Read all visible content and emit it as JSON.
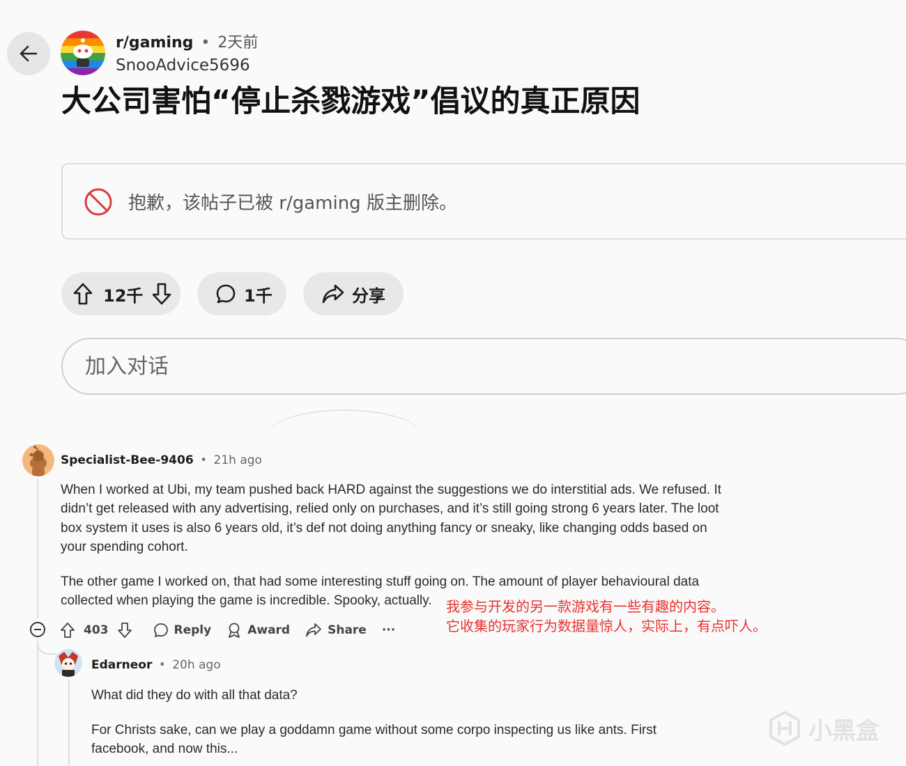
{
  "post": {
    "subreddit": "r/gaming",
    "separator": "•",
    "time": "2天前",
    "author": "SnooAdvice5696",
    "title": "大公司害怕“停止杀戮游戏”倡议的真正原因",
    "removed_notice": "抱歉，该帖子已被 r/gaming 版主删除。",
    "votes": "12千",
    "comments": "1千",
    "share_label": "分享",
    "join_placeholder": "加入对话"
  },
  "comments": [
    {
      "author": "Specialist-Bee-9406",
      "separator": "•",
      "time": "21h ago",
      "paragraphs": [
        "When I worked at Ubi, my team pushed back HARD against the suggestions we do interstitial ads. We refused. It didn’t get released with any advertising, relied only on purchases, and it’s still going strong 6 years later. The loot box system it uses is also 6 years old, it’s def not doing anything fancy or sneaky, like changing odds based on your spending cohort.",
        "The other game I worked on, that had some interesting stuff going on. The amount of player behavioural data collected when playing the game is incredible. Spooky, actually."
      ],
      "score": "403",
      "actions": {
        "reply": "Reply",
        "award": "Award",
        "share": "Share",
        "more": "···"
      }
    },
    {
      "author": "Edarneor",
      "separator": "•",
      "time": "20h ago",
      "paragraphs": [
        "What did they do with all that data?",
        "For Christs sake, can we play a goddamn game without some corpo inspecting us like ants. First facebook, and now this..."
      ]
    }
  ],
  "annotation": {
    "line1": "我参与开发的另一款游戏有一些有趣的内容。",
    "line2": "它收集的玩家行为数据量惊人，实际上，有点吓人。"
  },
  "watermark": "小黑盒",
  "colors": {
    "annotation": "#e8322e",
    "removed_icon": "#d93a3a",
    "pill_bg": "#e8e8e8"
  }
}
